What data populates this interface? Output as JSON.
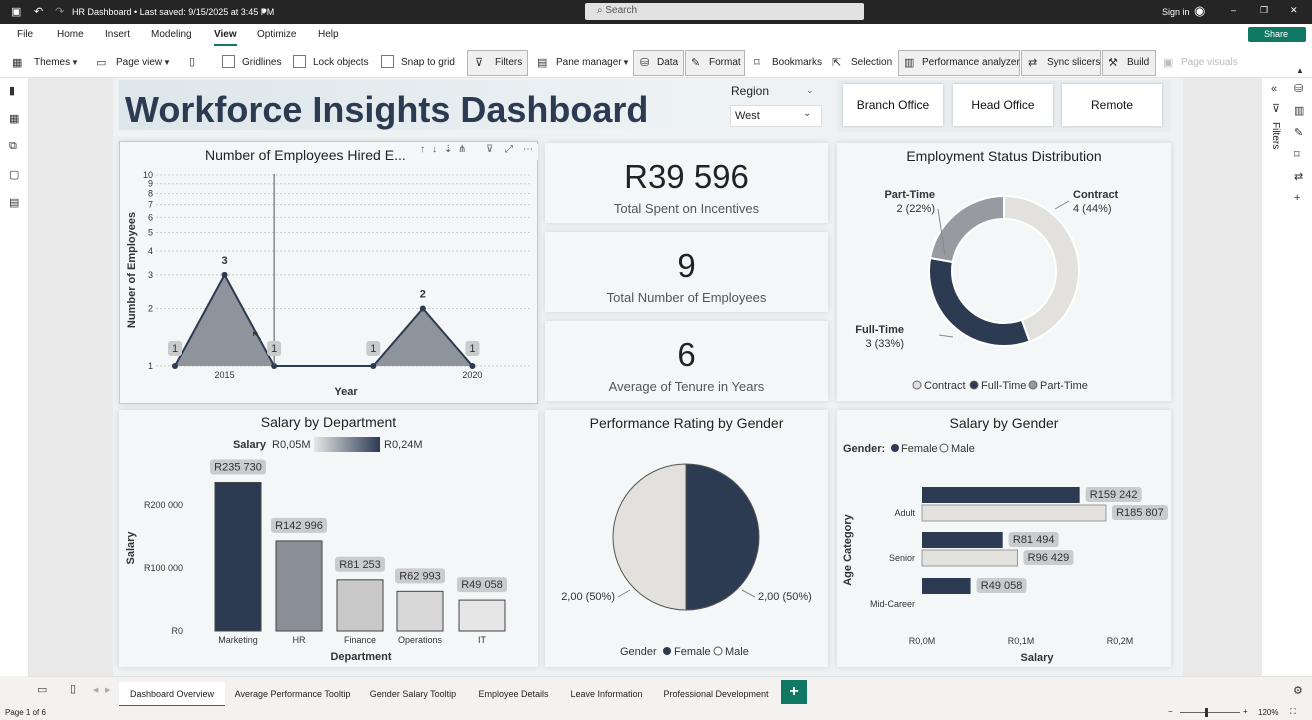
{
  "app": {
    "title": "HR Dashboard • Last saved: 9/15/2025 at 3:45 PM",
    "search_placeholder": "Search",
    "signin": "Sign in",
    "share": "Share"
  },
  "menu": [
    "File",
    "Home",
    "Insert",
    "Modeling",
    "View",
    "Optimize",
    "Help"
  ],
  "ribbon": {
    "themes": "Themes",
    "page_view": "Page view",
    "gridlines": "Gridlines",
    "lock_objects": "Lock objects",
    "snap": "Snap to grid",
    "filters": "Filters",
    "pane_manager": "Pane manager",
    "data": "Data",
    "format": "Format",
    "bookmarks": "Bookmarks",
    "selection": "Selection",
    "perf": "Performance analyzer",
    "sync": "Sync slicers",
    "build": "Build",
    "page_visuals": "Page visuals"
  },
  "dashboard": {
    "title": "Workforce Insights Dashboard",
    "region_label": "Region",
    "region_value": "West",
    "buttons": [
      "Branch Office",
      "Head Office",
      "Remote"
    ]
  },
  "kpis": [
    {
      "value": "R39 596",
      "label": "Total Spent on Incentives"
    },
    {
      "value": "9",
      "label": "Total Number of Employees"
    },
    {
      "value": "6",
      "label": "Average of Tenure in Years"
    }
  ],
  "chart_data": [
    {
      "type": "area",
      "title": "Number of Employees Hired E...",
      "xlabel": "Year",
      "ylabel": "Number of Employees",
      "x": [
        2014,
        2015,
        2016,
        2017,
        2018,
        2019,
        2020,
        2021
      ],
      "values": [
        1,
        3,
        1,
        null,
        1,
        2,
        1,
        null
      ],
      "yticks": [
        "1",
        "2",
        "3",
        "4",
        "5",
        "6",
        "7",
        "8",
        "9",
        "10"
      ],
      "xticks": [
        "2015",
        "2020"
      ],
      "data_labels": [
        "1",
        "3",
        "1",
        "1",
        "2",
        "1"
      ]
    },
    {
      "type": "bar",
      "title": "Salary by Department",
      "categories": [
        "Marketing",
        "HR",
        "Finance",
        "Operations",
        "IT"
      ],
      "values": [
        235730,
        142996,
        81253,
        62993,
        49058
      ],
      "labels": [
        "R235 730",
        "R142 996",
        "R81 253",
        "R62 993",
        "R49 058"
      ],
      "xlabel": "Department",
      "ylabel": "Salary",
      "yticks": [
        "R0",
        "R100 000",
        "R200 000"
      ],
      "legend": {
        "title": "Salary",
        "min": "R0,05M",
        "max": "R0,24M"
      }
    },
    {
      "type": "pie",
      "title": "Employment Status Distribution",
      "slices": [
        {
          "name": "Contract",
          "value": 4,
          "label": "4 (44%)",
          "color": "#e3e1de"
        },
        {
          "name": "Full-Time",
          "value": 3,
          "label": "3 (33%)",
          "color": "#2c3a52"
        },
        {
          "name": "Part-Time",
          "value": 2,
          "label": "2 (22%)",
          "color": "#979aa1"
        }
      ],
      "legend": [
        "Contract",
        "Full-Time",
        "Part-Time"
      ]
    },
    {
      "type": "pie",
      "title": "Performance Rating by Gender",
      "slices": [
        {
          "name": "Female",
          "value": 2,
          "label": "2,00 (50%)",
          "color": "#2c3a52"
        },
        {
          "name": "Male",
          "value": 2,
          "label": "2,00 (50%)",
          "color": "#e3e1de"
        }
      ],
      "legend_title": "Gender",
      "legend": [
        "Female",
        "Male"
      ]
    },
    {
      "type": "bar",
      "title": "Salary by Gender",
      "categories": [
        "Adult",
        "Senior",
        "Mid-Career"
      ],
      "series": [
        {
          "name": "Female",
          "values": [
            159242,
            81494,
            49058
          ],
          "labels": [
            "R159 242",
            "R81 494",
            "R49 058"
          ],
          "color": "#2c3a52"
        },
        {
          "name": "Male",
          "values": [
            185807,
            96429,
            null
          ],
          "labels": [
            "R185 807",
            "R96 429",
            ""
          ],
          "color": "#e3e1de"
        }
      ],
      "xlabel": "Salary",
      "ylabel": "Age Category",
      "xticks": [
        "R0,0M",
        "R0,1M",
        "R0,2M"
      ],
      "legend_title": "Gender:"
    }
  ],
  "tabs": [
    "Dashboard Overview",
    "Average Performance Tooltip",
    "Gender Salary Tooltip",
    "Employee Details",
    "Leave Information",
    "Professional Development"
  ],
  "status": {
    "page": "Page 1 of 6",
    "zoom": "120%"
  },
  "filters_pane": "Filters"
}
